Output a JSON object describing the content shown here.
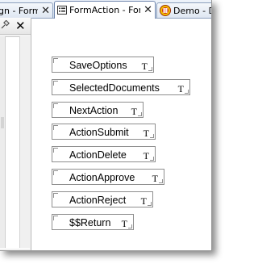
{
  "tabs": [
    {
      "label": "gn - Forms",
      "close": "✕",
      "active": false,
      "icon": "none"
    },
    {
      "label": "FormAction - Form",
      "close": "✕",
      "active": true,
      "icon": "form-icon"
    },
    {
      "label": "Demo - D",
      "close": "",
      "active": false,
      "icon": "demo-app-icon"
    }
  ],
  "left_panel": {
    "pin_icon": "pin-icon",
    "close_label": "✕"
  },
  "fields": [
    {
      "name": "SaveOptions",
      "type": "T"
    },
    {
      "name": "SelectedDocuments",
      "type": "T"
    },
    {
      "name": "NextAction",
      "type": "T"
    },
    {
      "name": "ActionSubmit",
      "type": "T"
    },
    {
      "name": "ActionDelete",
      "type": "T"
    },
    {
      "name": "ActionApprove",
      "type": "T"
    },
    {
      "name": "ActionReject",
      "type": "T"
    },
    {
      "name": "$$Return",
      "type": "T"
    }
  ]
}
